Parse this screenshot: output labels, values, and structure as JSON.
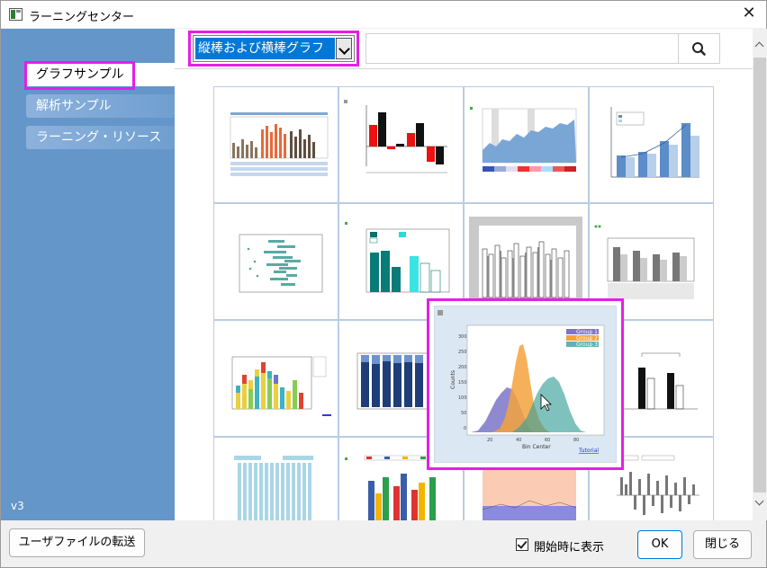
{
  "window": {
    "title": "ラーニングセンター",
    "close_glyph": "✕"
  },
  "sidebar": {
    "items": [
      {
        "label": "グラフサンプル",
        "active": true
      },
      {
        "label": "解析サンプル",
        "active": false
      },
      {
        "label": "ラーニング・リソース",
        "active": false
      }
    ],
    "version": "v3"
  },
  "toolbar": {
    "category_selected": "縦棒および横棒グラフ",
    "search_value": "",
    "search_icon": "search-icon"
  },
  "preview": {
    "legend": [
      "Group 1",
      "Group 2",
      "Group 3"
    ],
    "xlabel": "Bin Center",
    "ylabel": "Counts",
    "link": "Tutorial"
  },
  "footer": {
    "transfer_button": "ユーザファイルの転送",
    "startup_checkbox_label": "開始時に表示",
    "startup_checked": true,
    "ok_button": "OK",
    "close_button": "閉じる"
  },
  "colors": {
    "sidebar_bg": "#6496c9",
    "highlight": "#e51fe5",
    "selection": "#0078d7"
  }
}
